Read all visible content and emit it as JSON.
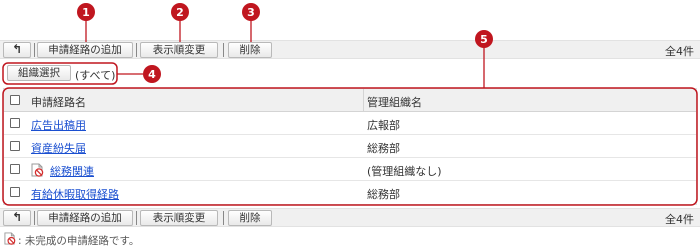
{
  "toolbar": {
    "back_label": "↰",
    "add_label": "申請経路の追加",
    "order_label": "表示順変更",
    "delete_label": "削除",
    "count": "全4件"
  },
  "org_filter": {
    "button_label": "組織選択",
    "value": "(すべて)"
  },
  "table": {
    "headers": [
      "申請経路名",
      "管理組織名"
    ],
    "rows": [
      {
        "name": "広告出稿用",
        "org": "広報部",
        "incomplete": false
      },
      {
        "name": "資産紛失届",
        "org": "総務部",
        "incomplete": false
      },
      {
        "name": "総務関連",
        "org": "(管理組織なし)",
        "incomplete": true
      },
      {
        "name": "有給休暇取得経路",
        "org": "総務部",
        "incomplete": false
      }
    ]
  },
  "markers": [
    "1",
    "2",
    "3",
    "4",
    "5"
  ],
  "legend": ": 未完成の申請経路です。",
  "colors": {
    "marker": "#c0161f",
    "link": "#1a4fd0",
    "toolbar_bg": "#f0f0f0"
  }
}
